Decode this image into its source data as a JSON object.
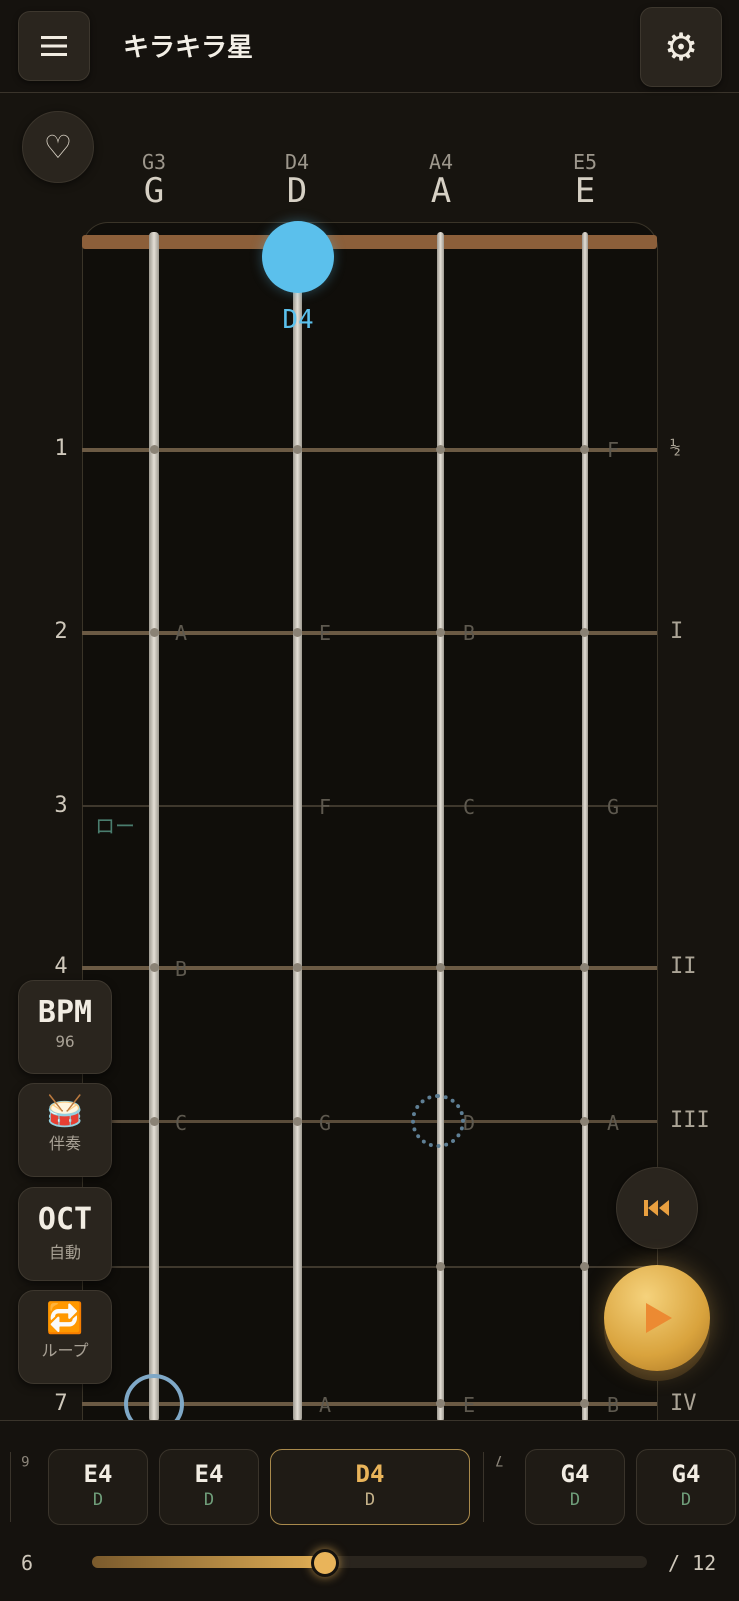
{
  "header": {
    "menu_icon": "hamburger-menu-icon",
    "title": "キラキラ星",
    "settings_icon": "gear-icon"
  },
  "favorite_icon": "heart-outline-icon",
  "strings": [
    {
      "octave": "G3",
      "name": "G"
    },
    {
      "octave": "D4",
      "name": "D"
    },
    {
      "octave": "A4",
      "name": "A"
    },
    {
      "octave": "E5",
      "name": "E"
    }
  ],
  "current_note": "D4",
  "fret_numbers": [
    "1",
    "2",
    "3",
    "4",
    "7"
  ],
  "position_marks": [
    "½",
    "I",
    "II",
    "III",
    "IV"
  ],
  "note_labels": {
    "fret1": [
      "F"
    ],
    "fret2": [
      "A",
      "E",
      "B"
    ],
    "fret3": [
      "F",
      "C",
      "G"
    ],
    "fret4": [
      "B"
    ],
    "fret5": [
      "C",
      "G",
      "D",
      "A"
    ],
    "fret7": [
      "A",
      "E",
      "B"
    ]
  },
  "fingering_hint": "ロー",
  "side_buttons": {
    "bpm": {
      "label": "BPM",
      "value": "96"
    },
    "accompaniment": {
      "icon": "drum-icon",
      "label": "伴奏"
    },
    "octave": {
      "label": "OCT",
      "value": "自動"
    },
    "loop": {
      "icon": "loop-icon",
      "label": "ループ"
    }
  },
  "transport": {
    "rewind_icon": "skip-to-start-icon",
    "play_icon": "play-icon"
  },
  "note_sequence": {
    "measure_a": "6",
    "measure_b": "7",
    "notes": [
      {
        "note": "E4",
        "string": "D"
      },
      {
        "note": "E4",
        "string": "D"
      },
      {
        "note": "D4",
        "string": "D",
        "active": true
      },
      {
        "note": "G4",
        "string": "D"
      },
      {
        "note": "G4",
        "string": "D"
      }
    ]
  },
  "progress": {
    "current": "6",
    "total": "/ 12",
    "fraction": 0.42
  },
  "colors": {
    "accent": "#e9b45a",
    "note_marker": "#5bc0ec",
    "background": "#17140f"
  }
}
